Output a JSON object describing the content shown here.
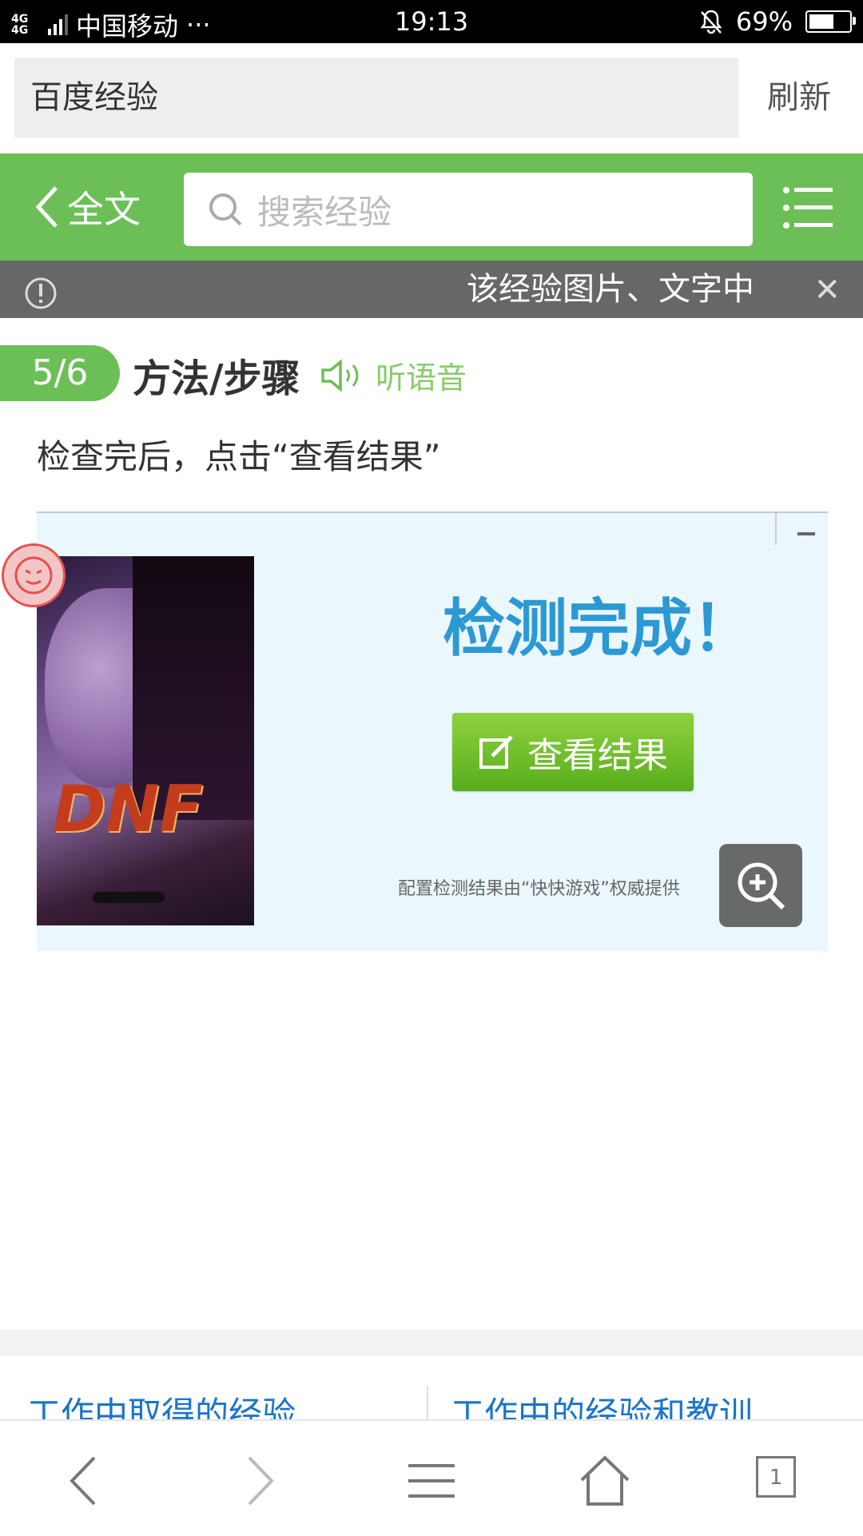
{
  "status_bar": {
    "network": "4G 4G",
    "carrier": "中国移动",
    "more": "···",
    "time": "19:13",
    "battery": "69%",
    "battery_level": 0.69
  },
  "address_bar": {
    "title": "百度经验",
    "refresh_label": "刷新"
  },
  "header": {
    "back_label": "全文",
    "search_placeholder": "搜索经验"
  },
  "notice": {
    "text": "该经验图片、文字中"
  },
  "step": {
    "counter": "5/6",
    "title": "方法/步骤",
    "listen_label": "听语音",
    "description": "检查完后，点击“查看结果”"
  },
  "step_image": {
    "done_title": "检测完成！",
    "result_button": "查看结果",
    "art_logo": "DNF",
    "footnote": "配置检测结果由“快快游戏”权威提供"
  },
  "related": {
    "left": "工作中取得的经验",
    "right": "工作中的经验和教训"
  },
  "bottom_toolbar": {
    "tab_count": "1"
  },
  "colors": {
    "accent_green": "#6cbf57",
    "link_blue": "#1a75c9",
    "notice_gray": "#676767"
  }
}
